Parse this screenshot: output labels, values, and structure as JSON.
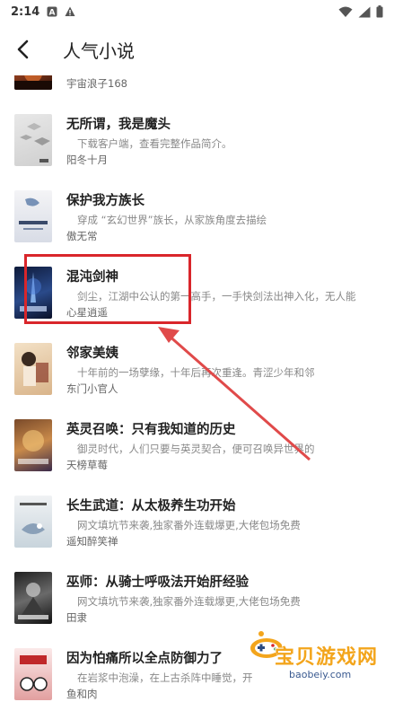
{
  "status_bar": {
    "time": "2:14"
  },
  "header": {
    "title": "人气小说"
  },
  "books": [
    {
      "title": "",
      "desc": "",
      "author": "宇宙浪子168"
    },
    {
      "title": "无所谓，我是魔头",
      "desc": "下载客户端，查看完整作品简介。",
      "author": "阳冬十月"
    },
    {
      "title": "保护我方族长",
      "desc": "穿成 “玄幻世界”族长，从家族角度去描绘",
      "author": "傲无常"
    },
    {
      "title": "混沌剑神",
      "desc": "剑尘，江湖中公认的第一高手，一手快剑法出神入化，无人能",
      "author": "心星逍遥"
    },
    {
      "title": "邻家美姨",
      "desc": "十年前的一场孽缘，十年后再次重逢。青涩少年和邻",
      "author": "东门小官人"
    },
    {
      "title": "英灵召唤：只有我知道的历史",
      "desc": "御灵时代，人们只要与英灵契合，便可召唤异世界的",
      "author": "天榜草莓"
    },
    {
      "title": "长生武道：从太极养生功开始",
      "desc": "网文填坑节来袭,独家番外连载爆更,大佬包场免费",
      "author": "遥知醉笑禅"
    },
    {
      "title": "巫师：从骑士呼吸法开始肝经验",
      "desc": "网文填坑节来袭,独家番外连载爆更,大佬包场免费",
      "author": "田隶"
    },
    {
      "title": "因为怕痛所以全点防御力了",
      "desc": "在岩浆中泡澡，在上古杀阵中睡觉，开",
      "author": "鱼和肉"
    }
  ],
  "watermark": {
    "title": "宝贝游戏网",
    "url": "baobeiy.com"
  },
  "colors": {
    "highlight": "#d9262b",
    "watermark": "#f3a51c"
  }
}
